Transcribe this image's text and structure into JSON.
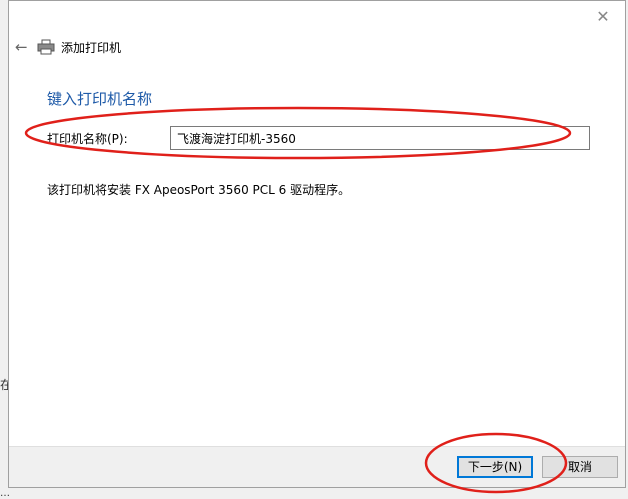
{
  "backdrop": {
    "left_char": "在",
    "bottom_text": "…"
  },
  "window": {
    "close_glyph": "✕",
    "back_glyph": "←",
    "title": "添加打印机"
  },
  "content": {
    "heading": "键入打印机名称",
    "printer_name_label": "打印机名称(P):",
    "printer_name_value": "飞渡海淀打印机-3560",
    "driver_note": "该打印机将安装 FX ApeosPort 3560 PCL 6 驱动程序。"
  },
  "footer": {
    "next_label": "下一步(N)",
    "cancel_label": "取消"
  },
  "colors": {
    "heading": "#1e5aa8",
    "annotation": "#e0201a",
    "default_button_border": "#0078d7"
  }
}
